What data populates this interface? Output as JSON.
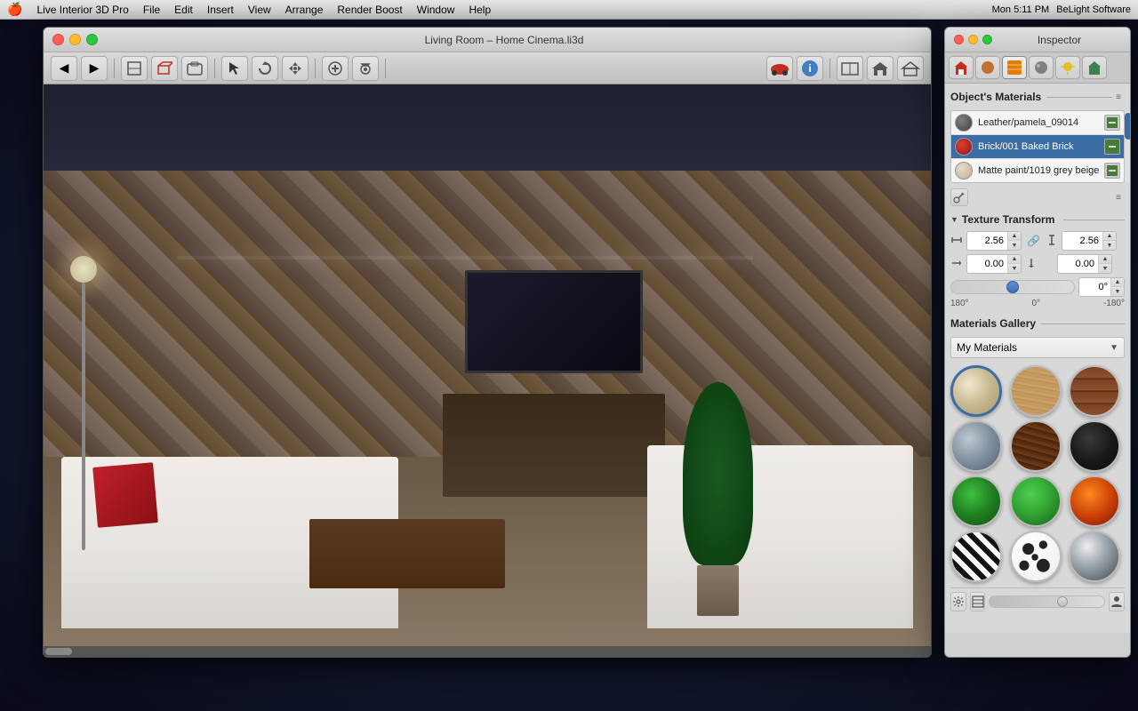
{
  "menubar": {
    "apple": "🍎",
    "items": [
      {
        "label": "Live Interior 3D Pro"
      },
      {
        "label": "File"
      },
      {
        "label": "Edit"
      },
      {
        "label": "Insert"
      },
      {
        "label": "View"
      },
      {
        "label": "Arrange"
      },
      {
        "label": "Render Boost"
      },
      {
        "label": "Window"
      },
      {
        "label": "Help"
      }
    ],
    "right": {
      "time": "Mon 5:11 PM",
      "company": "BeLight Software"
    }
  },
  "main_window": {
    "title": "Living Room – Home Cinema.li3d"
  },
  "inspector": {
    "title": "Inspector",
    "tabs": [
      {
        "label": "🏠",
        "icon": "house-icon"
      },
      {
        "label": "⚙",
        "icon": "object-icon"
      },
      {
        "label": "🖌",
        "icon": "material-icon",
        "active": true
      },
      {
        "label": "💧",
        "icon": "texture-icon"
      },
      {
        "label": "💡",
        "icon": "light-icon"
      },
      {
        "label": "🏛",
        "icon": "room-icon"
      }
    ],
    "objects_materials": {
      "title": "Object's Materials",
      "materials": [
        {
          "name": "Leather/pamela_09014",
          "swatch_color": "#5a5a5a",
          "selected": false
        },
        {
          "name": "Brick/001 Baked Brick",
          "swatch_color": "#c03020",
          "selected": true
        },
        {
          "name": "Matte paint/1019 grey beige",
          "swatch_color": "#d8c8b0",
          "selected": false
        }
      ]
    },
    "texture_transform": {
      "title": "Texture Transform",
      "width_value": "2.56",
      "height_value": "2.56",
      "offset_x": "0.00",
      "offset_y": "0.00",
      "rotation_value": "0°",
      "rotation_min": "180°",
      "rotation_mid": "0°",
      "rotation_max": "-180°"
    },
    "materials_gallery": {
      "title": "Materials Gallery",
      "dropdown_label": "My Materials",
      "swatches": [
        {
          "name": "beige-plaster",
          "type": "beige"
        },
        {
          "name": "wood-light",
          "type": "wood_light"
        },
        {
          "name": "brick-material",
          "type": "brick"
        },
        {
          "name": "metal-material",
          "type": "metal"
        },
        {
          "name": "wood-dark",
          "type": "wood_dark"
        },
        {
          "name": "black-material",
          "type": "black"
        },
        {
          "name": "green-material",
          "type": "green"
        },
        {
          "name": "green2-material",
          "type": "green2"
        },
        {
          "name": "fire-material",
          "type": "fire"
        },
        {
          "name": "zebra-material",
          "type": "zebra"
        },
        {
          "name": "spots-material",
          "type": "spots"
        },
        {
          "name": "chrome-material",
          "type": "chrome"
        }
      ]
    }
  },
  "toolbar": {
    "nav_back": "◀",
    "nav_forward": "▶",
    "tools": [
      "□",
      "⟳",
      "⊕",
      "●",
      "◎",
      "◉",
      "⚒",
      "📷",
      "🚗",
      "ℹ",
      "□□",
      "🏠",
      "🏛"
    ]
  }
}
